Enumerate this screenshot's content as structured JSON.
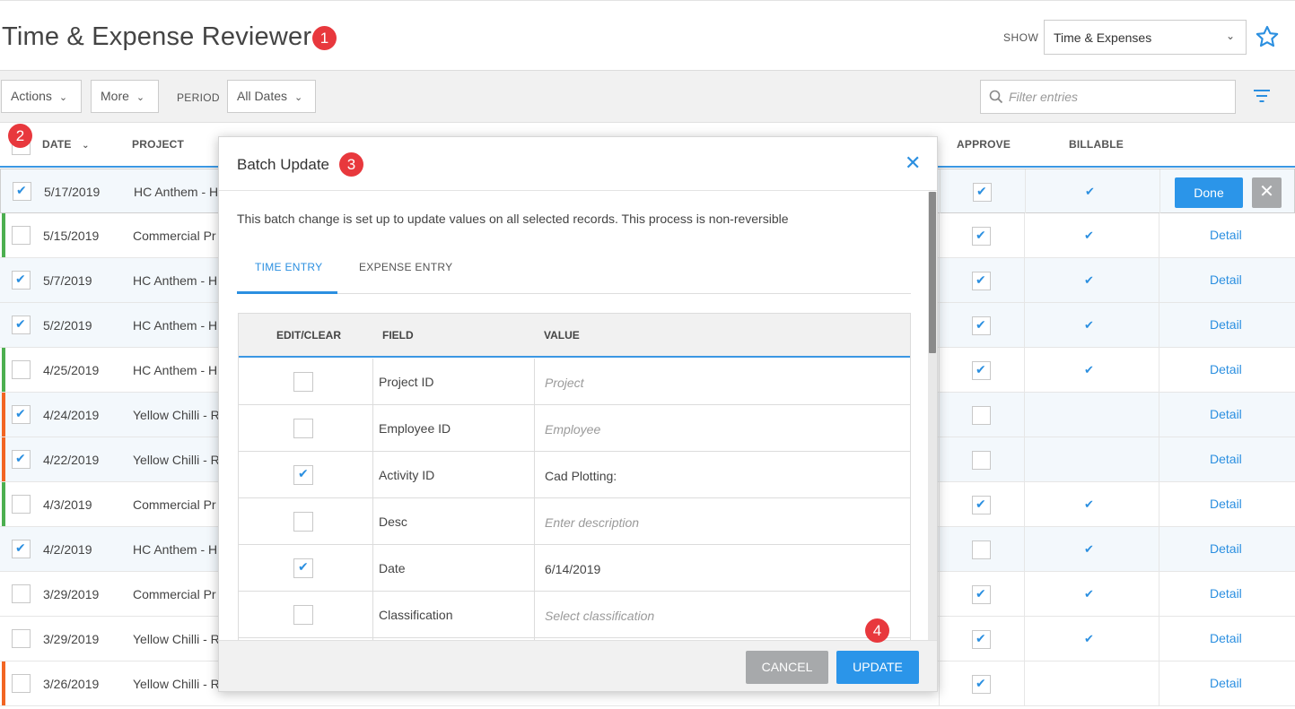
{
  "header": {
    "title": "Time & Expense Reviewer",
    "show_label": "SHOW",
    "show_value": "Time & Expenses",
    "markers": [
      "1",
      "2",
      "3",
      "4"
    ]
  },
  "toolbar": {
    "actions_label": "Actions",
    "more_label": "More",
    "period_label": "PERIOD",
    "period_value": "All Dates",
    "filter_placeholder": "Filter entries"
  },
  "table": {
    "columns": {
      "date": "DATE",
      "project": "PROJECT",
      "approve": "APPROVE",
      "billable": "BILLABLE"
    },
    "done_label": "Done",
    "detail_label": "Detail",
    "rows": [
      {
        "date": "5/17/2019",
        "project": "HC Anthem - H",
        "selected": true,
        "approve": true,
        "billable": true,
        "status": "none",
        "editing": true
      },
      {
        "date": "5/15/2019",
        "project": "Commercial Pr",
        "selected": false,
        "approve": true,
        "billable": true,
        "status": "green"
      },
      {
        "date": "5/7/2019",
        "project": "HC Anthem - H",
        "selected": true,
        "approve": true,
        "billable": true,
        "status": "none"
      },
      {
        "date": "5/2/2019",
        "project": "HC Anthem - H",
        "selected": true,
        "approve": true,
        "billable": true,
        "status": "none"
      },
      {
        "date": "4/25/2019",
        "project": "HC Anthem - H",
        "selected": false,
        "approve": true,
        "billable": true,
        "status": "green"
      },
      {
        "date": "4/24/2019",
        "project": "Yellow Chilli - R",
        "selected": true,
        "approve": false,
        "billable": false,
        "status": "orange"
      },
      {
        "date": "4/22/2019",
        "project": "Yellow Chilli - R",
        "selected": true,
        "approve": false,
        "billable": false,
        "status": "orange"
      },
      {
        "date": "4/3/2019",
        "project": "Commercial Pr",
        "selected": false,
        "approve": true,
        "billable": true,
        "status": "green"
      },
      {
        "date": "4/2/2019",
        "project": "HC Anthem - H",
        "selected": true,
        "approve": false,
        "billable": true,
        "status": "none"
      },
      {
        "date": "3/29/2019",
        "project": "Commercial Pr",
        "selected": false,
        "approve": true,
        "billable": true,
        "status": "none"
      },
      {
        "date": "3/29/2019",
        "project": "Yellow Chilli - R",
        "selected": false,
        "approve": true,
        "billable": true,
        "status": "none"
      },
      {
        "date": "3/26/2019",
        "project": "Yellow Chilli - R",
        "selected": false,
        "approve": true,
        "billable": false,
        "status": "orange"
      }
    ]
  },
  "modal": {
    "title": "Batch Update",
    "info": "This batch change is set up to update values on all selected records. This process is non-reversible",
    "tabs": [
      "TIME ENTRY",
      "EXPENSE ENTRY"
    ],
    "columns": {
      "edit": "EDIT/CLEAR",
      "field": "FIELD",
      "value": "VALUE"
    },
    "fields": [
      {
        "checked": false,
        "name": "Project ID",
        "value": "Project",
        "placeholder": true
      },
      {
        "checked": false,
        "name": "Employee ID",
        "value": "Employee",
        "placeholder": true
      },
      {
        "checked": true,
        "name": "Activity ID",
        "value": "Cad Plotting:",
        "placeholder": false
      },
      {
        "checked": false,
        "name": "Desc",
        "value": "Enter description",
        "placeholder": true
      },
      {
        "checked": true,
        "name": "Date",
        "value": "6/14/2019",
        "placeholder": false
      },
      {
        "checked": false,
        "name": "Classification",
        "value": "Select classification",
        "placeholder": true
      },
      {
        "checked": false,
        "name": "",
        "value": "",
        "placeholder": true
      }
    ],
    "cancel_label": "CANCEL",
    "update_label": "UPDATE"
  },
  "colors": {
    "accent": "#2b95e9",
    "marker": "#e8383d",
    "status_green": "#4caf50",
    "status_orange": "#f26522",
    "muted_button": "#a7a9ab"
  }
}
